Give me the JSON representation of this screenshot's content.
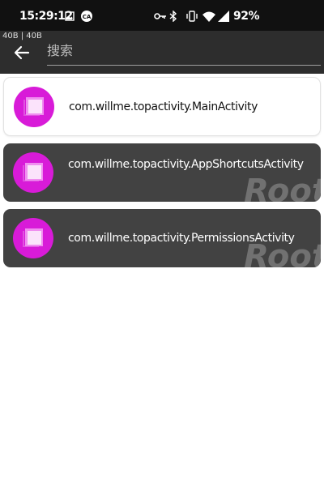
{
  "status_bar": {
    "time": "15:29:12",
    "battery": "92%",
    "icons": [
      "image-icon",
      "ca-icon",
      "vpn-key-icon",
      "bluetooth-icon",
      "vibrate-icon",
      "wifi-icon",
      "signal-icon"
    ]
  },
  "header": {
    "net_speed": "40B | 40B",
    "search_placeholder": "搜索",
    "back_icon": "arrow-back-icon"
  },
  "activities": [
    {
      "label": "com.willme.topactivity.MainActivity",
      "style": "light",
      "badge": ""
    },
    {
      "label": "com.willme.topactivity.AppShortcutsActivity",
      "style": "dark",
      "badge": "Root"
    },
    {
      "label": "com.willme.topactivity.PermissionsActivity",
      "style": "dark",
      "badge": "Root"
    }
  ],
  "colors": {
    "header_bg": "#2d2d2d",
    "status_bg": "#111111",
    "icon_magenta": "#d81bd8",
    "dark_card_bg": "#424242"
  }
}
